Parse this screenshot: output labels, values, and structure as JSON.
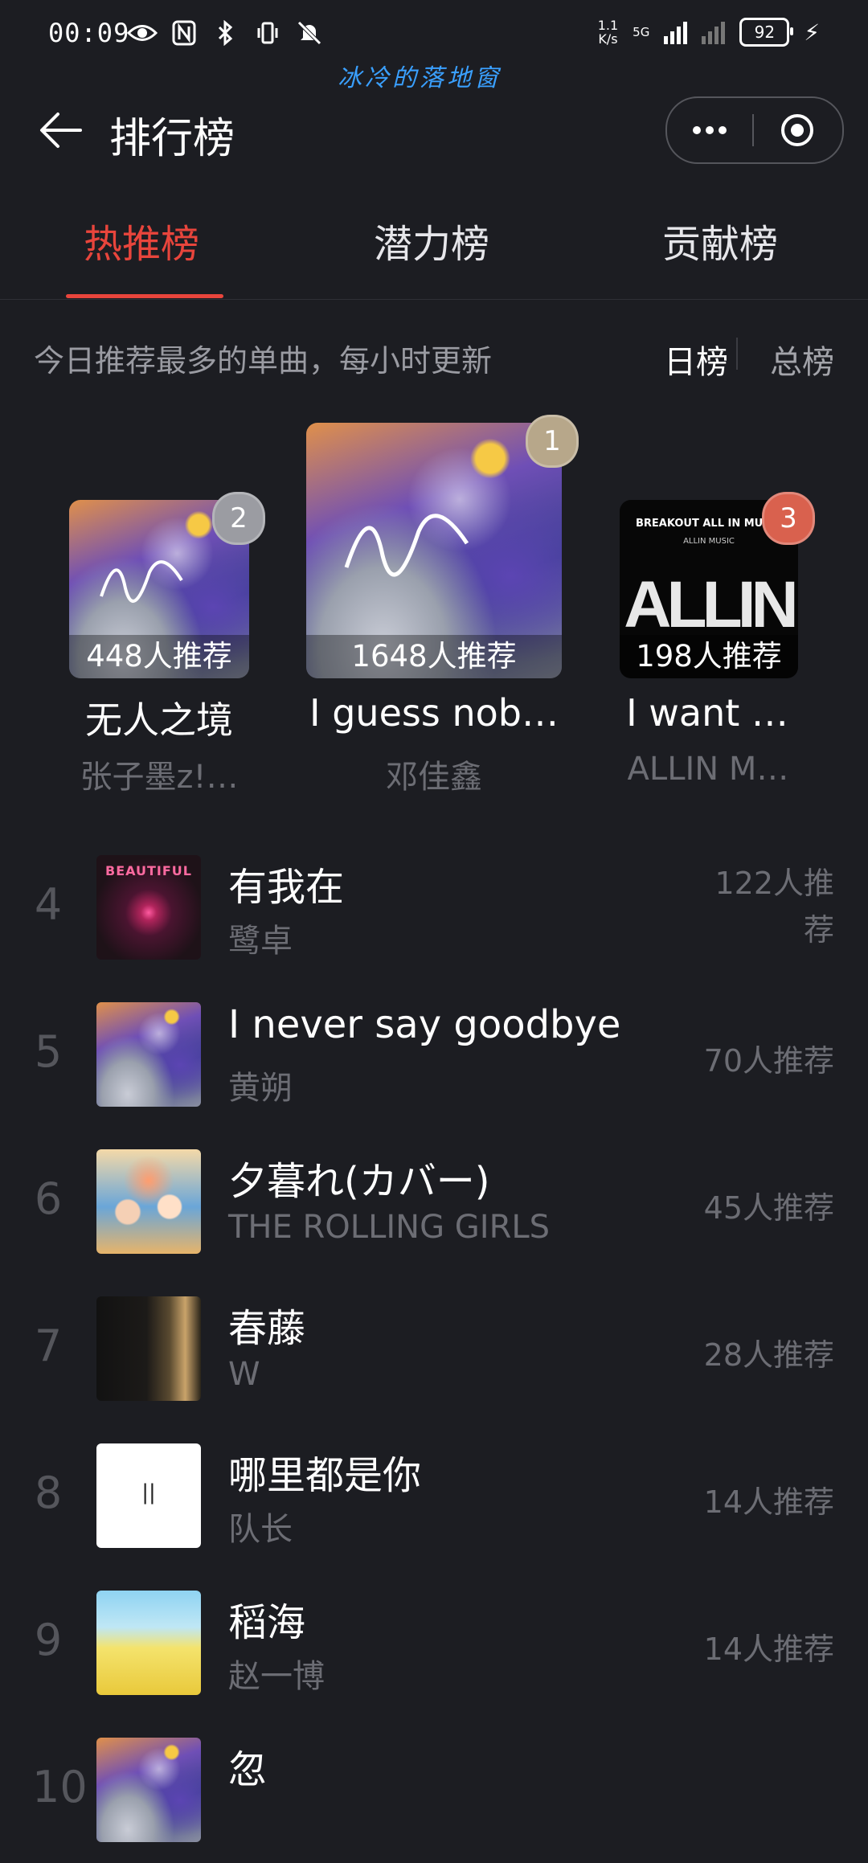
{
  "status_bar": {
    "time": "00:09",
    "net_speed_top": "1.1",
    "net_speed_bottom": "K/s",
    "network_type": "5G",
    "battery": "92",
    "icons_left": [
      "eye-icon",
      "nfc-icon",
      "bluetooth-icon",
      "vibrate-icon",
      "mute-icon"
    ]
  },
  "watermark": "冰冷的落地窗",
  "header": {
    "title": "排行榜"
  },
  "tabs": [
    {
      "label": "热推榜",
      "active": true
    },
    {
      "label": "潜力榜",
      "active": false
    },
    {
      "label": "贡献榜",
      "active": false
    }
  ],
  "subheader": {
    "description": "今日推荐最多的单曲，每小时更新",
    "day_label": "日榜",
    "total_label": "总榜"
  },
  "podium": [
    {
      "rank": "1",
      "title": "I guess nob…",
      "artist": "邓佳鑫",
      "count": "1648人推荐"
    },
    {
      "rank": "2",
      "title": "无人之境",
      "artist": "张子墨z!…",
      "count": "448人推荐"
    },
    {
      "rank": "3",
      "title": "I want …",
      "artist": "ALLIN M…",
      "count": "198人推荐"
    }
  ],
  "cover_text": {
    "beautiful": "BEAUTIFUL",
    "allin_top": "BREAKOUT ALL IN MUSIC",
    "allin_sub": "ALLIN MUSIC",
    "allin_big": "ALLIN",
    "nali": "||"
  },
  "list": [
    {
      "rank": "4",
      "title": "有我在",
      "artist": "鹭卓",
      "count": "122人推荐"
    },
    {
      "rank": "5",
      "title": "I never say goodbye",
      "artist": "黄朔",
      "count": "70人推荐"
    },
    {
      "rank": "6",
      "title": "夕暮れ(カバー)",
      "artist": "THE ROLLING GIRLS",
      "count": "45人推荐"
    },
    {
      "rank": "7",
      "title": "春藤",
      "artist": "W",
      "count": "28人推荐"
    },
    {
      "rank": "8",
      "title": "哪里都是你",
      "artist": "队长",
      "count": "14人推荐"
    },
    {
      "rank": "9",
      "title": "稻海",
      "artist": "赵一博",
      "count": "14人推荐"
    },
    {
      "rank": "10",
      "title": "忽",
      "artist": "",
      "count": ""
    }
  ],
  "colors": {
    "background": "#1c1d22",
    "accent": "#e8453c",
    "rank1_badge": "#b7a78a",
    "rank2_badge": "#9b9ca2",
    "rank3_badge": "#d9614e"
  }
}
